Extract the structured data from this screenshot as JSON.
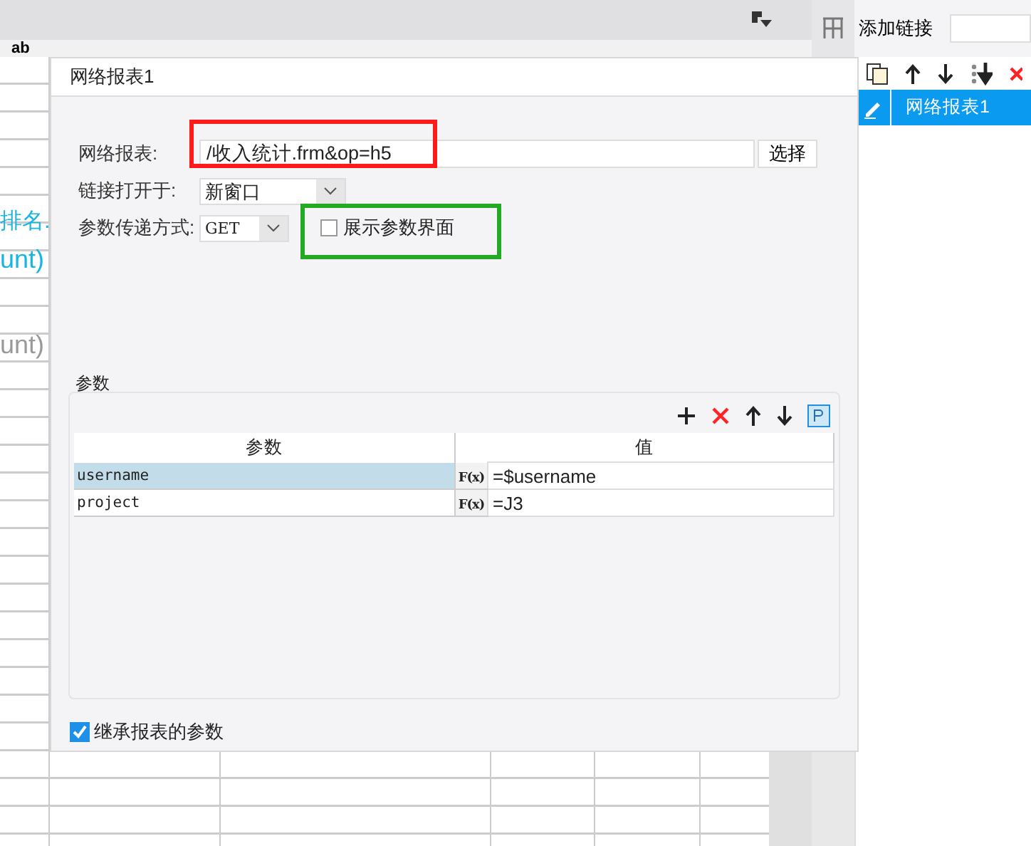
{
  "background_sheet": {
    "toolbar_text": "ab",
    "cells": [
      {
        "text": "排名.",
        "kind": "link"
      },
      {
        "text": "unt)",
        "kind": "link"
      },
      {
        "text": "unt)",
        "kind": "plain"
      }
    ]
  },
  "dialog": {
    "title": "网络报表1",
    "fields": [
      {
        "label": "网络报表:",
        "kind": "text",
        "value": "/收入统计.frm&op=h5",
        "button": "选择"
      },
      {
        "label": "链接打开于:",
        "kind": "select",
        "value": "新窗口"
      },
      {
        "label": "参数传递方式:",
        "kind": "select",
        "value": "GET"
      }
    ],
    "show_params": {
      "label": "展示参数界面",
      "checked": false
    },
    "params": {
      "legend": "参数",
      "columns": [
        "参数",
        "值"
      ],
      "rows": [
        {
          "name": "username",
          "formula": "F(x)",
          "value": "=$username",
          "selected": true
        },
        {
          "name": "project",
          "formula": "F(x)",
          "value": "=J3",
          "selected": false
        }
      ]
    },
    "inherit": {
      "label": "继承报表的参数",
      "checked": true
    }
  },
  "annotations": [
    {
      "color": "#ff1a1a"
    },
    {
      "color": "#22aa22"
    }
  ],
  "links_panel": {
    "label": "添加链接",
    "items": [
      {
        "name": "网络报表1",
        "selected": true
      }
    ]
  }
}
